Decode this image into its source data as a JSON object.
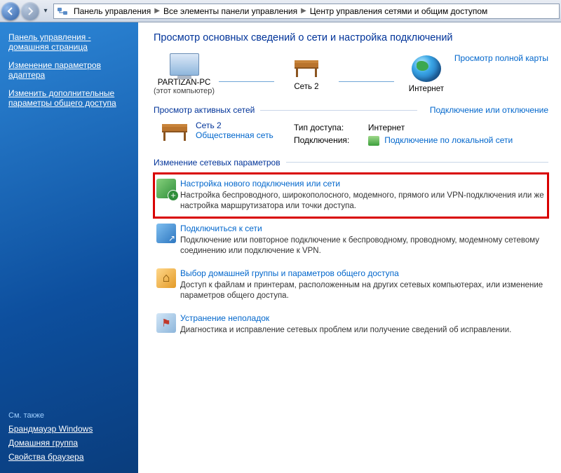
{
  "breadcrumb": {
    "items": [
      "Панель управления",
      "Все элементы панели управления",
      "Центр управления сетями и общим доступом"
    ]
  },
  "sidebar": {
    "top": [
      "Панель управления - домашняя страница",
      "Изменение параметров адаптера",
      "Изменить дополнительные параметры общего доступа"
    ],
    "also_label": "См. также",
    "bottom": [
      "Брандмауэр Windows",
      "Домашняя группа",
      "Свойства браузера"
    ]
  },
  "main": {
    "heading": "Просмотр основных сведений о сети и настройка подключений",
    "full_map_link": "Просмотр полной карты",
    "nodes": {
      "computer": {
        "label": "PARTIZAN-PC",
        "sublabel": "(этот компьютер)"
      },
      "network": {
        "label": "Сеть 2"
      },
      "internet": {
        "label": "Интернет"
      }
    },
    "active": {
      "section_label": "Просмотр активных сетей",
      "right_link": "Подключение или отключение",
      "name": "Сеть 2",
      "type": "Общественная сеть",
      "props": {
        "access_label": "Тип доступа:",
        "access_value": "Интернет",
        "conn_label": "Подключения:",
        "conn_value": "Подключение по локальной сети"
      }
    },
    "settings": {
      "section_label": "Изменение сетевых параметров",
      "tasks": [
        {
          "title": "Настройка нового подключения или сети",
          "desc": "Настройка беспроводного, широкополосного, модемного, прямого или VPN-подключения или же настройка маршрутизатора или точки доступа."
        },
        {
          "title": "Подключиться к сети",
          "desc": "Подключение или повторное подключение к беспроводному, проводному, модемному сетевому соединению или подключение к VPN."
        },
        {
          "title": "Выбор домашней группы и параметров общего доступа",
          "desc": "Доступ к файлам и принтерам, расположенным на других сетевых компьютерах, или изменение параметров общего доступа."
        },
        {
          "title": "Устранение неполадок",
          "desc": "Диагностика и исправление сетевых проблем или получение сведений об исправлении."
        }
      ]
    }
  }
}
